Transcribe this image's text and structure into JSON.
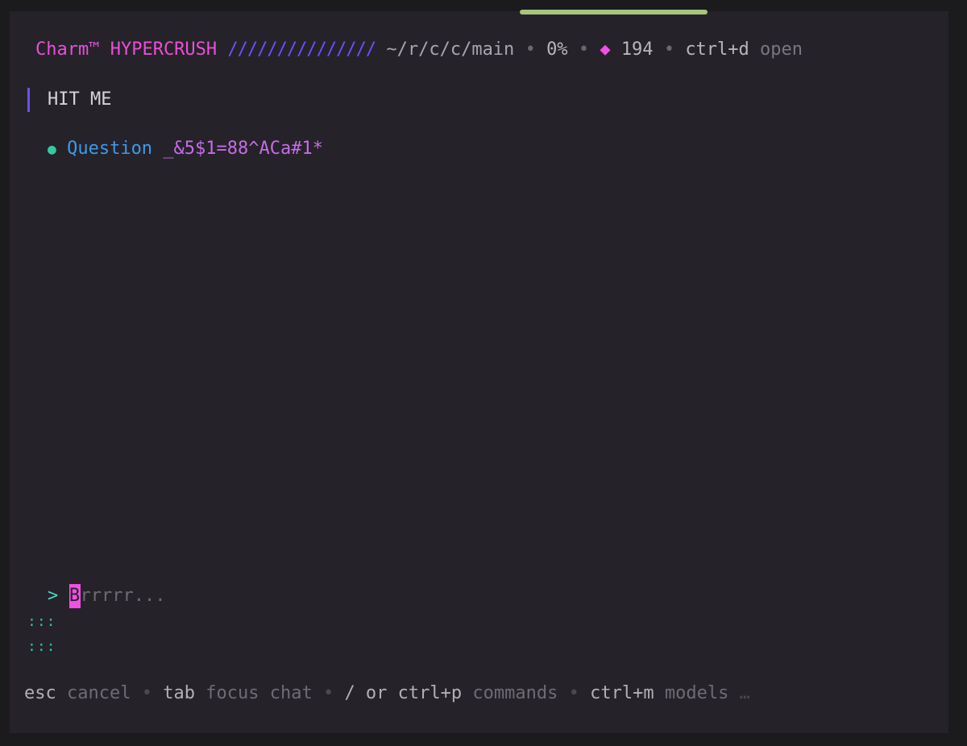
{
  "header": {
    "brand": "Charm™ HYPERCRUSH",
    "slashes": "///////////////",
    "path": "~/r/c/c/main",
    "separator": "•",
    "percent": "0%",
    "diamond": "◆",
    "count": "194",
    "shortcut_key": "ctrl+d",
    "shortcut_desc": "open"
  },
  "message": {
    "text": "HIT ME"
  },
  "question": {
    "bullet": "●",
    "label": "Question",
    "code": "_&5$1=88^ACa#1*"
  },
  "prompt": {
    "caret": ">",
    "cursor_char": "B",
    "placeholder": "rrrrr..."
  },
  "continuation": {
    "marker": ":::"
  },
  "footer": {
    "items": [
      {
        "key": "esc",
        "desc": "cancel"
      },
      {
        "key": "tab",
        "desc": "focus chat"
      },
      {
        "key": "/ or ctrl+p",
        "desc": "commands"
      },
      {
        "key": "ctrl+m",
        "desc": "models"
      }
    ],
    "separator": "•",
    "more": "…"
  },
  "colors": {
    "brand": "#e84fd7",
    "accent_purple": "#6b50ff",
    "accent_green": "#a8c47f",
    "bullet_green": "#34c9a2",
    "question_blue": "#3b9bea",
    "cursor_pink": "#f24fe6"
  }
}
